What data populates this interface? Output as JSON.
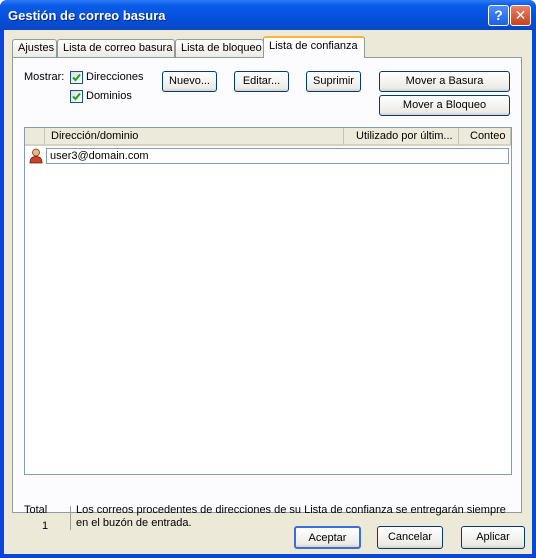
{
  "window": {
    "title": "Gestión de correo basura",
    "help_glyph": "?",
    "close_glyph": "✕"
  },
  "tabs": [
    {
      "label": "Ajustes"
    },
    {
      "label": "Lista de correo basura"
    },
    {
      "label": "Lista de bloqueo"
    },
    {
      "label": "Lista de confianza",
      "active": true
    }
  ],
  "filter": {
    "label": "Mostrar:",
    "options": [
      {
        "label": "Direcciones",
        "checked": true
      },
      {
        "label": "Dominios",
        "checked": true
      }
    ]
  },
  "buttons": {
    "new": "Nuevo...",
    "edit": "Editar...",
    "delete": "Suprimir",
    "move_junk": "Mover a Basura",
    "move_block": "Mover a Bloqueo"
  },
  "list": {
    "columns": [
      "Dirección/dominio",
      "Utilizado por últim...",
      "Conteo"
    ],
    "rows": [
      {
        "address": "user3@domain.com",
        "icon": "contact-icon"
      }
    ]
  },
  "footer": {
    "total_label": "Total",
    "total_value": "1",
    "info": "Los correos procedentes de direcciones de su Lista de confianza se entregarán siempre en el buzón de entrada."
  },
  "dialog_buttons": {
    "ok": "Aceptar",
    "cancel": "Cancelar",
    "apply": "Aplicar"
  },
  "colors": {
    "titlebar": "#0550dc",
    "tab_highlight": "#f9b43a",
    "face": "#ece9d8"
  }
}
